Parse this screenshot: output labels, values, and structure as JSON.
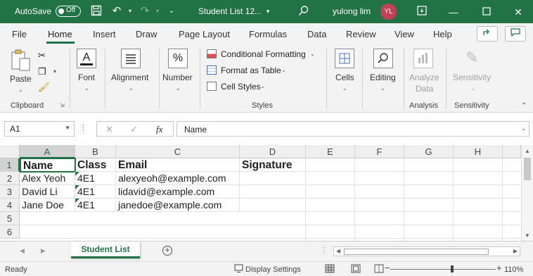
{
  "title_bar": {
    "autosave_label": "AutoSave",
    "autosave_state": "Off",
    "document_name": "Student List 12...",
    "user_name": "yulong lim",
    "user_initials": "YL",
    "accent_color": "#217346"
  },
  "menu": {
    "tabs": [
      "File",
      "Home",
      "Insert",
      "Draw",
      "Page Layout",
      "Formulas",
      "Data",
      "Review",
      "View",
      "Help"
    ],
    "active": "Home"
  },
  "ribbon": {
    "clipboard": {
      "paste": "Paste",
      "group": "Clipboard"
    },
    "font": {
      "label": "Font"
    },
    "alignment": {
      "label": "Alignment"
    },
    "number": {
      "label": "Number"
    },
    "styles": {
      "conditional": "Conditional Formatting",
      "format_table": "Format as Table",
      "cell_styles": "Cell Styles",
      "group": "Styles"
    },
    "cells": {
      "label": "Cells"
    },
    "editing": {
      "label": "Editing"
    },
    "analysis": {
      "analyze_line1": "Analyze",
      "analyze_line2": "Data",
      "group": "Analysis"
    },
    "sensitivity": {
      "label": "Sensitivity",
      "group": "Sensitivity"
    }
  },
  "formula_bar": {
    "name_box": "A1",
    "fx_symbol": "fx",
    "formula": "Name"
  },
  "sheet": {
    "columns": [
      "A",
      "B",
      "C",
      "D",
      "E",
      "F",
      "G",
      "H"
    ],
    "rows": [
      "1",
      "2",
      "3",
      "4",
      "5",
      "6"
    ],
    "header": [
      "Name",
      "Class",
      "Email",
      "Signature"
    ],
    "data": [
      [
        "Alex Yeoh",
        "4E1",
        "alexyeoh@example.com",
        ""
      ],
      [
        "David Li",
        "4E1",
        "lidavid@example.com",
        ""
      ],
      [
        "Jane Doe",
        "4E1",
        "janedoe@example.com",
        ""
      ]
    ]
  },
  "tabs": {
    "sheet_name": "Student List",
    "add_symbol": "+"
  },
  "status": {
    "ready": "Ready",
    "display_settings": "Display Settings",
    "zoom": "110%"
  }
}
